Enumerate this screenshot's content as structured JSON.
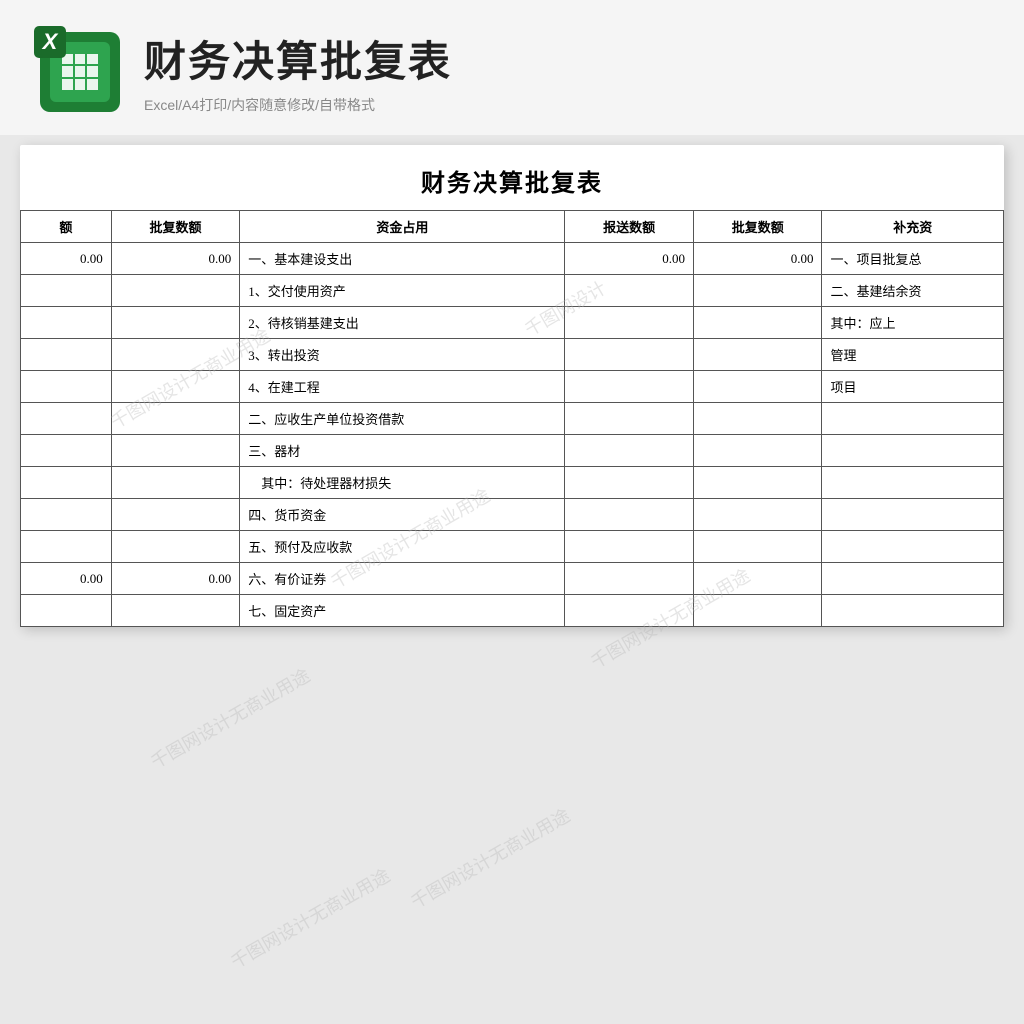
{
  "header": {
    "title": "财务决算批复表",
    "subtitle": "Excel/A4打印/内容随意修改/自带格式",
    "excel_icon_letter": "X"
  },
  "doc": {
    "title": "财务决算批复表",
    "columns": [
      {
        "label": "额",
        "sub": "批复数额",
        "key": "col1"
      },
      {
        "label": "资金占用",
        "key": "col_zijin"
      },
      {
        "label": "报送数额",
        "key": "col_baosong"
      },
      {
        "label": "批复数额",
        "key": "col_pifu2"
      },
      {
        "label": "补充资",
        "key": "col_buchong"
      }
    ],
    "header_row": {
      "col_fuze": "额",
      "col_pifu": "批复数额",
      "col_zijin": "资金占用",
      "col_baosong": "报送数额",
      "col_pifu2": "批复数额",
      "col_buchong": "补充资"
    },
    "rows": [
      {
        "col_fuze": "0.00",
        "col_pifu": "0.00",
        "col_zijin": "一、基本建设支出",
        "col_baosong": "0.00",
        "col_pifu2": "0.00",
        "col_buchong": "一、项目批复总"
      },
      {
        "col_fuze": "",
        "col_pifu": "",
        "col_zijin": "1、交付使用资产",
        "col_baosong": "",
        "col_pifu2": "",
        "col_buchong": "二、基建结余资"
      },
      {
        "col_fuze": "",
        "col_pifu": "",
        "col_zijin": "2、待核销基建支出",
        "col_baosong": "",
        "col_pifu2": "",
        "col_buchong": "其中：应上"
      },
      {
        "col_fuze": "",
        "col_pifu": "",
        "col_zijin": "3、转出投资",
        "col_baosong": "",
        "col_pifu2": "",
        "col_buchong": "管理"
      },
      {
        "col_fuze": "",
        "col_pifu": "",
        "col_zijin": "4、在建工程",
        "col_baosong": "",
        "col_pifu2": "",
        "col_buchong": "项目"
      },
      {
        "col_fuze": "",
        "col_pifu": "",
        "col_zijin": "二、应收生产单位投资借款",
        "col_baosong": "",
        "col_pifu2": "",
        "col_buchong": ""
      },
      {
        "col_fuze": "",
        "col_pifu": "",
        "col_zijin": "三、器材",
        "col_baosong": "",
        "col_pifu2": "",
        "col_buchong": ""
      },
      {
        "col_fuze": "",
        "col_pifu": "",
        "col_zijin": "　其中：待处理器材损失",
        "col_baosong": "",
        "col_pifu2": "",
        "col_buchong": ""
      },
      {
        "col_fuze": "",
        "col_pifu": "",
        "col_zijin": "四、货币资金",
        "col_baosong": "",
        "col_pifu2": "",
        "col_buchong": ""
      },
      {
        "col_fuze": "",
        "col_pifu": "",
        "col_zijin": "五、预付及应收款",
        "col_baosong": "",
        "col_pifu2": "",
        "col_buchong": ""
      },
      {
        "col_fuze": "0.00",
        "col_pifu": "0.00",
        "col_zijin": "六、有价证券",
        "col_baosong": "",
        "col_pifu2": "",
        "col_buchong": ""
      },
      {
        "col_fuze": "",
        "col_pifu": "",
        "col_zijin": "七、固定资产",
        "col_baosong": "",
        "col_pifu2": "",
        "col_buchong": ""
      }
    ],
    "watermarks": [
      "无商业用途",
      "千图网设计",
      "无商业用途",
      "千图网设计",
      "千图网",
      "无商业用途",
      "千图网设计"
    ]
  },
  "watermark_text": "无商业用途"
}
